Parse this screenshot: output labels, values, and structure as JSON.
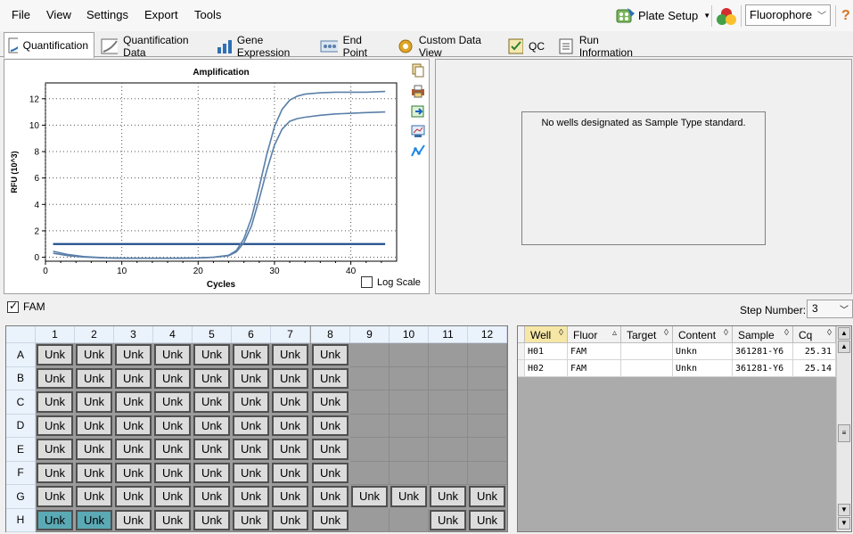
{
  "menu": {
    "file": "File",
    "view": "View",
    "settings": "Settings",
    "export": "Export",
    "tools": "Tools"
  },
  "toolbar": {
    "plate_setup_label": "Plate Setup",
    "fluorophore_label": "Fluorophore",
    "help_glyph": "?"
  },
  "tabs": [
    {
      "label": "Quantification",
      "active": true
    },
    {
      "label": "Quantification Data"
    },
    {
      "label": "Gene Expression"
    },
    {
      "label": "End Point"
    },
    {
      "label": "Custom Data View"
    },
    {
      "label": "QC"
    },
    {
      "label": "Run Information"
    }
  ],
  "chart": {
    "log_scale_label": "Log Scale"
  },
  "chart_data": {
    "type": "line",
    "title": "Amplification",
    "xlabel": "Cycles",
    "ylabel": "RFU (10^3)",
    "xlim": [
      0,
      46
    ],
    "ylim": [
      -0.3,
      13.2
    ],
    "xticks": [
      0,
      10,
      20,
      30,
      40
    ],
    "yticks": [
      0,
      2,
      4,
      6,
      8,
      10,
      12
    ],
    "grid": true,
    "threshold": 1.0,
    "series": [
      {
        "color": "#5a7fa8",
        "x": [
          1,
          3,
          5,
          8,
          11,
          14,
          17,
          20,
          22,
          24,
          25,
          26,
          27,
          28,
          29,
          30,
          31,
          32,
          33,
          34,
          36,
          38,
          40,
          42,
          44.5
        ],
        "y": [
          0.45,
          0.2,
          0.05,
          -0.05,
          -0.08,
          -0.08,
          -0.08,
          -0.05,
          0.0,
          0.15,
          0.5,
          1.4,
          3.0,
          5.3,
          7.8,
          9.9,
          11.2,
          11.9,
          12.2,
          12.35,
          12.45,
          12.5,
          12.5,
          12.5,
          12.55
        ]
      },
      {
        "color": "#5a7fa8",
        "x": [
          1,
          3,
          5,
          8,
          11,
          14,
          17,
          20,
          22,
          24,
          25,
          26,
          27,
          28,
          29,
          30,
          31,
          32,
          33,
          34,
          36,
          38,
          40,
          42,
          44.5
        ],
        "y": [
          0.3,
          0.12,
          0.02,
          -0.05,
          -0.08,
          -0.08,
          -0.08,
          -0.05,
          0.0,
          0.12,
          0.4,
          1.1,
          2.4,
          4.4,
          6.6,
          8.5,
          9.7,
          10.3,
          10.5,
          10.6,
          10.75,
          10.85,
          10.9,
          10.95,
          11.0
        ]
      }
    ]
  },
  "right_panel": {
    "message": "No wells designated as Sample Type standard."
  },
  "fam_bar": {
    "fam_label": "FAM",
    "step_label": "Step Number:",
    "step_value": "3"
  },
  "plate": {
    "columns": [
      "1",
      "2",
      "3",
      "4",
      "5",
      "6",
      "7",
      "8",
      "9",
      "10",
      "11",
      "12"
    ],
    "rows": [
      "A",
      "B",
      "C",
      "D",
      "E",
      "F",
      "G",
      "H"
    ],
    "well_label": "Unk"
  },
  "results": {
    "headers": [
      "Well",
      "Fluor",
      "Target",
      "Content",
      "Sample",
      "Cq"
    ],
    "rows": [
      {
        "well": "H01",
        "fluor": "FAM",
        "target": "",
        "content": "Unkn",
        "sample": "361281-Y6",
        "cq": "25.31"
      },
      {
        "well": "H02",
        "fluor": "FAM",
        "target": "",
        "content": "Unkn",
        "sample": "361281-Y6",
        "cq": "25.14"
      }
    ]
  }
}
